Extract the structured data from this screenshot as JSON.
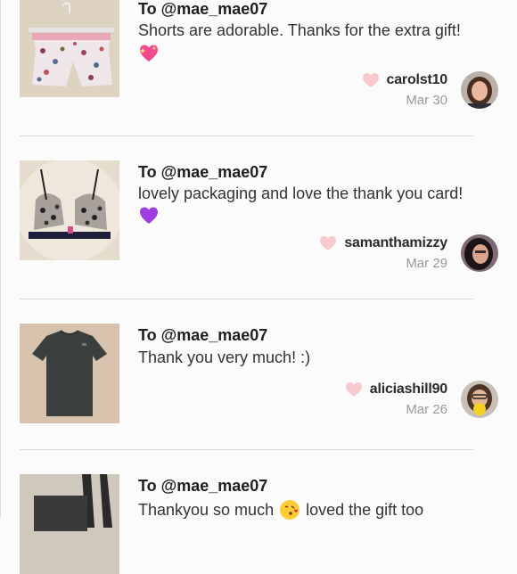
{
  "reviews": [
    {
      "to": "To @mae_mae07",
      "message": "Shorts are adorable. Thanks for the extra gift!",
      "emoji": "sparkling-heart-emoji",
      "username": "carolst10",
      "date": "Mar 30"
    },
    {
      "to": "To @mae_mae07",
      "message": "lovely packaging and love the thank you card!",
      "emoji": "purple-heart-emoji",
      "username": "samanthamizzy",
      "date": "Mar 29"
    },
    {
      "to": "To @mae_mae07",
      "message": "Thank you very much! :)",
      "emoji": "",
      "username": "aliciashill90",
      "date": "Mar 26"
    },
    {
      "to": "To @mae_mae07",
      "message_before": "Thankyou so much",
      "message_after": "loved the gift too",
      "emoji": "face-blowing-kiss-emoji"
    }
  ],
  "colors": {
    "heart": "#f9c9d0",
    "divider": "#d9d9d9",
    "date": "#9a9a9a"
  }
}
